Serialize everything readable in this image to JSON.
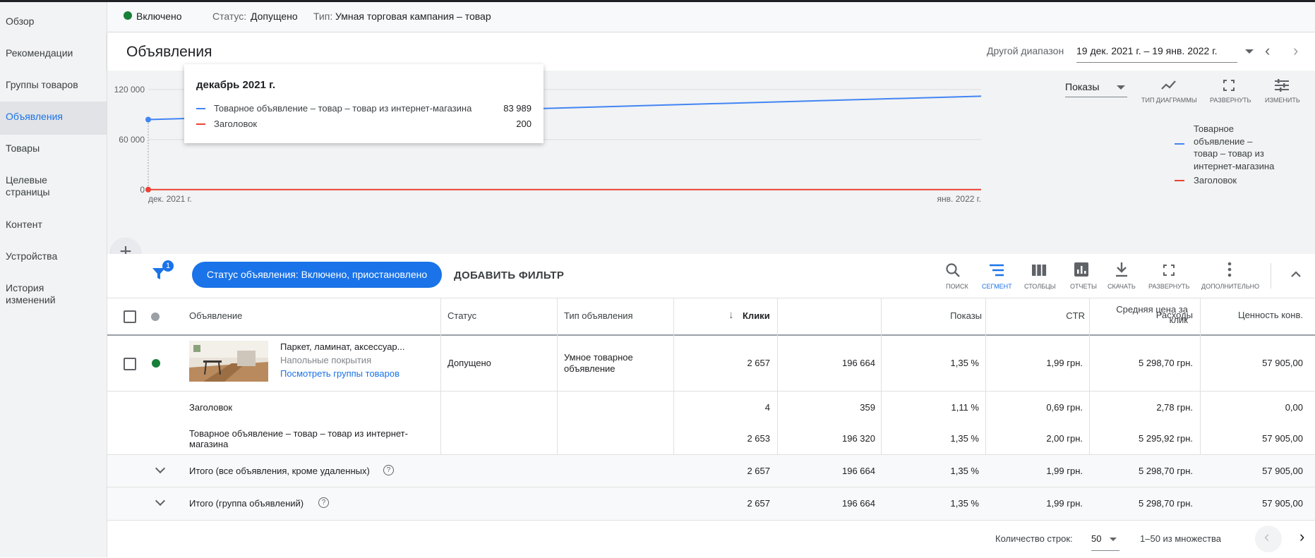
{
  "sidebar": {
    "items": [
      {
        "label": "Обзор"
      },
      {
        "label": "Рекомендации"
      },
      {
        "label": "Группы товаров"
      },
      {
        "label": "Объявления"
      },
      {
        "label": "Товары"
      },
      {
        "label": "Целевые страницы"
      },
      {
        "label": "Контент"
      },
      {
        "label": "Устройства"
      },
      {
        "label": "История изменений"
      }
    ],
    "plus": "+"
  },
  "status_bar": {
    "enabled": "Включено",
    "status_label": "Статус:",
    "status_value": "Допущено",
    "type_label": "Тип:",
    "type_value": "Умная торговая кампания – товар"
  },
  "header": {
    "title": "Объявления",
    "range_label": "Другой диапазон",
    "range_value": "19 дек. 2021 г. – 19 янв. 2022 г."
  },
  "chart": {
    "metric_select": "Показы",
    "tools": {
      "type": "ТИП ДИАГРАММЫ",
      "expand": "РАЗВЕРНУТЬ",
      "edit": "ИЗМЕНИТЬ"
    },
    "tooltip": {
      "title": "декабрь 2021 г.",
      "rows": [
        {
          "label": "Товарное объявление – товар – товар из интернет-магазина",
          "value": "83 989"
        },
        {
          "label": "Заголовок",
          "value": "200"
        }
      ]
    },
    "legend": [
      {
        "line1": "Товарное",
        "line2": "объявление –",
        "line3": "товар – товар из",
        "line4": "интернет-магазина"
      },
      {
        "line1": "Заголовок"
      }
    ],
    "colors": {
      "series1": "#4285f4",
      "series2": "#ea4335"
    }
  },
  "chart_data": {
    "type": "line",
    "x": [
      "дек. 2021 г.",
      "янв. 2022 г."
    ],
    "yticks": [
      "0",
      "60 000",
      "120 000"
    ],
    "ylim": [
      0,
      130000
    ],
    "series": [
      {
        "name": "Товарное объявление – товар – товар из интернет-магазина",
        "values": [
          83989,
          112000
        ]
      },
      {
        "name": "Заголовок",
        "values": [
          200,
          159
        ]
      }
    ]
  },
  "filterbar": {
    "badge": "1",
    "chip": "Статус объявления: Включено, приостановлено",
    "add_filter": "ДОБАВИТЬ ФИЛЬТР",
    "tools": [
      {
        "label": "ПОИСК"
      },
      {
        "label": "СЕГМЕНТ"
      },
      {
        "label": "СТОЛБЦЫ"
      },
      {
        "label": "ОТЧЕТЫ"
      },
      {
        "label": "СКАЧАТЬ"
      },
      {
        "label": "РАЗВЕРНУТЬ"
      },
      {
        "label": "ДОПОЛНИТЕЛЬНО"
      }
    ]
  },
  "table": {
    "headers": {
      "ad": "Объявление",
      "status": "Статус",
      "type": "Тип объявления",
      "clicks": "Клики",
      "impr": "Показы",
      "ctr": "CTR",
      "cpc1": "Средняя цена за",
      "cpc2": "клик",
      "cost": "Расходы",
      "conv": "Ценность конв."
    },
    "main_row": {
      "title": "Паркет, ламинат, аксессуар...",
      "subtitle": "Напольные покрытия",
      "link": "Посмотреть группы товаров",
      "status": "Допущено",
      "type1": "Умное товарное",
      "type2": "объявление",
      "clicks": "2 657",
      "impr": "196 664",
      "ctr": "1,35 %",
      "cpc": "1,99 грн.",
      "cost": "5 298,70 грн.",
      "conv": "57 905,00"
    },
    "seg_rows": [
      {
        "label1": "Заголовок",
        "label2": "",
        "clicks": "4",
        "impr": "359",
        "ctr": "1,11 %",
        "cpc": "0,69 грн.",
        "cost": "2,78 грн.",
        "conv": "0,00"
      },
      {
        "label1": "Товарное объявление – товар – товар из интернет-",
        "label2": "магазина",
        "clicks": "2 653",
        "impr": "196 320",
        "ctr": "1,35 %",
        "cpc": "2,00 грн.",
        "cost": "5 295,92 грн.",
        "conv": "57 905,00"
      }
    ],
    "totals": [
      {
        "label": "Итого (все объявления, кроме удаленных)",
        "clicks": "2 657",
        "impr": "196 664",
        "ctr": "1,35 %",
        "cpc": "1,99 грн.",
        "cost": "5 298,70 грн.",
        "conv": "57 905,00"
      },
      {
        "label": "Итого (группа объявлений)",
        "clicks": "2 657",
        "impr": "196 664",
        "ctr": "1,35 %",
        "cpc": "1,99 грн.",
        "cost": "5 298,70 грн.",
        "conv": "57 905,00"
      }
    ]
  },
  "footer": {
    "rows_label": "Количество строк:",
    "rows_value": "50",
    "range": "1–50 из множества"
  }
}
